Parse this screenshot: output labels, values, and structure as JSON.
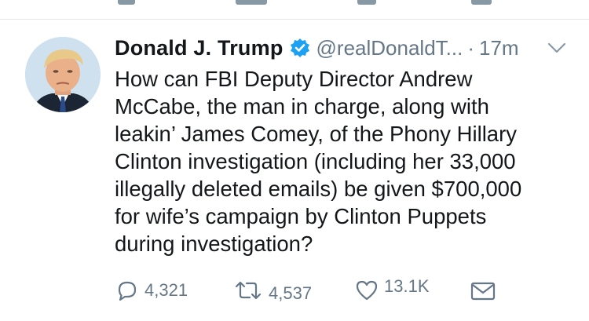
{
  "tweet": {
    "display_name": "Donald J. Trump",
    "handle": "@realDonaldT...",
    "separator": "·",
    "timestamp": "17m",
    "text": "How can FBI Deputy Director Andrew\nMcCabe, the man in charge, along with\nleakin’ James Comey, of the Phony Hillary\nClinton investigation (including her 33,000\nillegally deleted emails) be given $700,000\nfor wife’s campaign by Clinton Puppets\nduring investigation?",
    "verified": true
  },
  "actions": {
    "replies": "4,321",
    "retweets": "4,537",
    "likes": "13.1K"
  },
  "icons": {
    "verified": "verified-badge-icon",
    "chevron": "chevron-down-icon",
    "reply": "reply-icon",
    "retweet": "retweet-icon",
    "like": "heart-icon",
    "dm": "envelope-icon"
  },
  "colors": {
    "text": "#14171a",
    "secondary": "#657786",
    "verified_blue": "#1da1f2",
    "divider": "#e1e8ed"
  }
}
